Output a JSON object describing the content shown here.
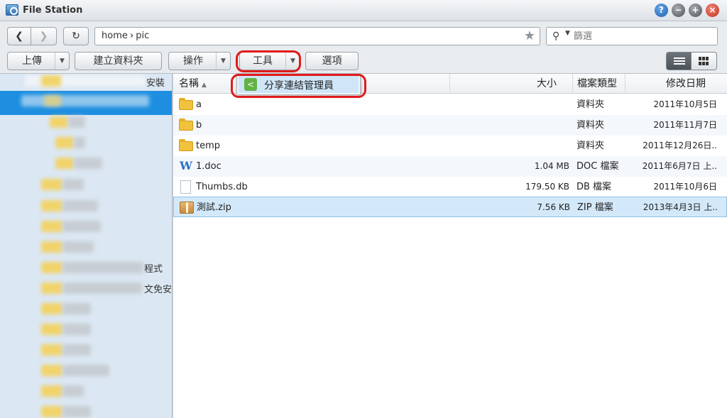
{
  "window": {
    "title": "File Station",
    "controls": [
      "help-icon",
      "minimize-icon",
      "maximize-icon",
      "close-icon"
    ]
  },
  "nav": {
    "path": [
      "home",
      "pic"
    ],
    "search_placeholder": "篩選"
  },
  "toolbar": {
    "upload": "上傳",
    "new_folder": "建立資料夾",
    "action": "操作",
    "tools": "工具",
    "options": "選項"
  },
  "tools_menu": {
    "items": [
      {
        "label": "分享連結管理員",
        "icon": "share-icon"
      }
    ]
  },
  "sidebar": {
    "visible_text": [
      "安裝",
      "程式",
      "文免安"
    ]
  },
  "columns": {
    "name": "名稱",
    "size": "大小",
    "type": "檔案類型",
    "modified": "修改日期"
  },
  "files": [
    {
      "name": "a",
      "size": "",
      "type": "資料夾",
      "modified": "2011年10月5日",
      "icon": "folder-icon"
    },
    {
      "name": "b",
      "size": "",
      "type": "資料夾",
      "modified": "2011年11月7日",
      "icon": "folder-icon"
    },
    {
      "name": "temp",
      "size": "",
      "type": "資料夾",
      "modified": "2011年12月26日..",
      "icon": "folder-icon"
    },
    {
      "name": "1.doc",
      "size": "1.04 MB",
      "type": "DOC 檔案",
      "modified": "2011年6月7日 上..",
      "icon": "word-icon"
    },
    {
      "name": "Thumbs.db",
      "size": "179.50 KB",
      "type": "DB 檔案",
      "modified": "2011年10月6日",
      "icon": "file-icon"
    },
    {
      "name": "測試.zip",
      "size": "7.56 KB",
      "type": "ZIP 檔案",
      "modified": "2013年4月3日 上..",
      "icon": "zip-icon"
    }
  ],
  "colors": {
    "accent_selection": "#1e8fe0",
    "highlight_ring": "#e01b1b",
    "menu_highlight": "#cfe6f8"
  }
}
